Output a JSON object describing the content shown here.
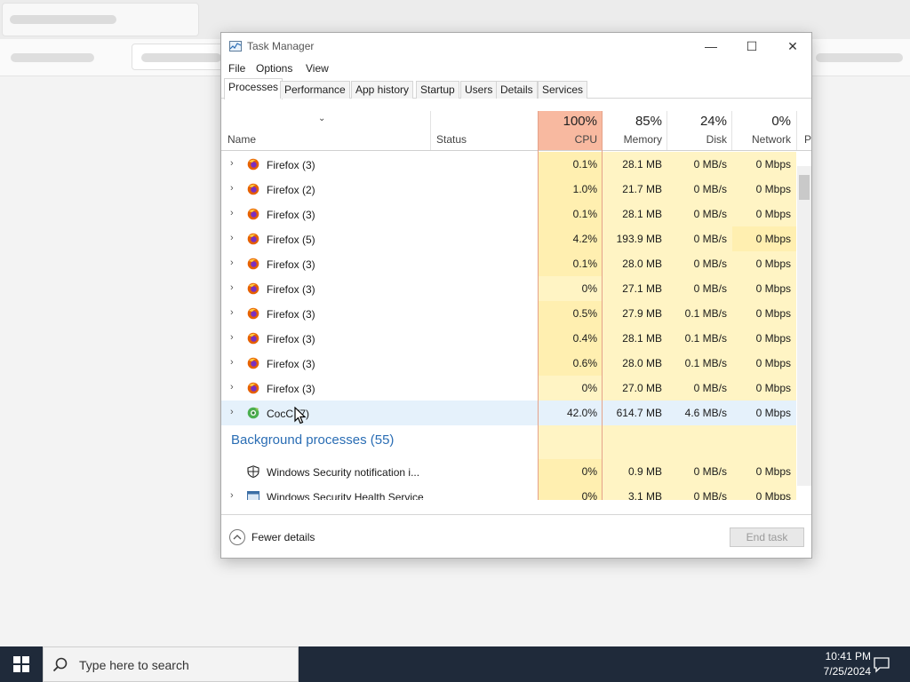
{
  "window": {
    "title": "Task Manager",
    "controls": {
      "minimize": "—",
      "maximize": "☐",
      "close": "✕"
    }
  },
  "menu": [
    "File",
    "Options",
    "View"
  ],
  "tabs": [
    "Processes",
    "Performance",
    "App history",
    "Startup",
    "Users",
    "Details",
    "Services"
  ],
  "columns": {
    "name": "Name",
    "status": "Status",
    "cpu": {
      "pct": "100%",
      "label": "CPU"
    },
    "memory": {
      "pct": "85%",
      "label": "Memory"
    },
    "disk": {
      "pct": "24%",
      "label": "Disk"
    },
    "network": {
      "pct": "0%",
      "label": "Network"
    },
    "power_partial": "P"
  },
  "processes": [
    {
      "name": "Firefox (3)",
      "cpu": "0.1%",
      "memory": "28.1 MB",
      "disk": "0 MB/s",
      "network": "0 Mbps"
    },
    {
      "name": "Firefox (2)",
      "cpu": "1.0%",
      "memory": "21.7 MB",
      "disk": "0 MB/s",
      "network": "0 Mbps"
    },
    {
      "name": "Firefox (3)",
      "cpu": "0.1%",
      "memory": "28.1 MB",
      "disk": "0 MB/s",
      "network": "0 Mbps"
    },
    {
      "name": "Firefox (5)",
      "cpu": "4.2%",
      "memory": "193.9 MB",
      "disk": "0 MB/s",
      "network": "0 Mbps"
    },
    {
      "name": "Firefox (3)",
      "cpu": "0.1%",
      "memory": "28.0 MB",
      "disk": "0 MB/s",
      "network": "0 Mbps"
    },
    {
      "name": "Firefox (3)",
      "cpu": "0%",
      "memory": "27.1 MB",
      "disk": "0 MB/s",
      "network": "0 Mbps"
    },
    {
      "name": "Firefox (3)",
      "cpu": "0.5%",
      "memory": "27.9 MB",
      "disk": "0.1 MB/s",
      "network": "0 Mbps"
    },
    {
      "name": "Firefox (3)",
      "cpu": "0.4%",
      "memory": "28.1 MB",
      "disk": "0.1 MB/s",
      "network": "0 Mbps"
    },
    {
      "name": "Firefox (3)",
      "cpu": "0.6%",
      "memory": "28.0 MB",
      "disk": "0.1 MB/s",
      "network": "0 Mbps"
    },
    {
      "name": "Firefox (3)",
      "cpu": "0%",
      "memory": "27.0 MB",
      "disk": "0 MB/s",
      "network": "0 Mbps"
    },
    {
      "name": "CocC (7)",
      "cpu": "42.0%",
      "memory": "614.7 MB",
      "disk": "4.6 MB/s",
      "network": "0 Mbps"
    }
  ],
  "background_group": "Background processes (55)",
  "background_processes": [
    {
      "name": "Windows Security notification i...",
      "cpu": "0%",
      "memory": "0.9 MB",
      "disk": "0 MB/s",
      "network": "0 Mbps"
    },
    {
      "name": "Windows Security Health Service",
      "cpu": "0%",
      "memory": "3.1 MB",
      "disk": "0 MB/s",
      "network": "0 Mbps"
    }
  ],
  "footer": {
    "fewer_details": "Fewer details",
    "end_task": "End task"
  },
  "taskbar": {
    "search_placeholder": "Type here to search",
    "time": "10:41 PM",
    "date": "7/25/2024"
  },
  "colors": {
    "firefox": "#e66000",
    "cocc": "#4caf50",
    "accent": "#2a6db4"
  }
}
